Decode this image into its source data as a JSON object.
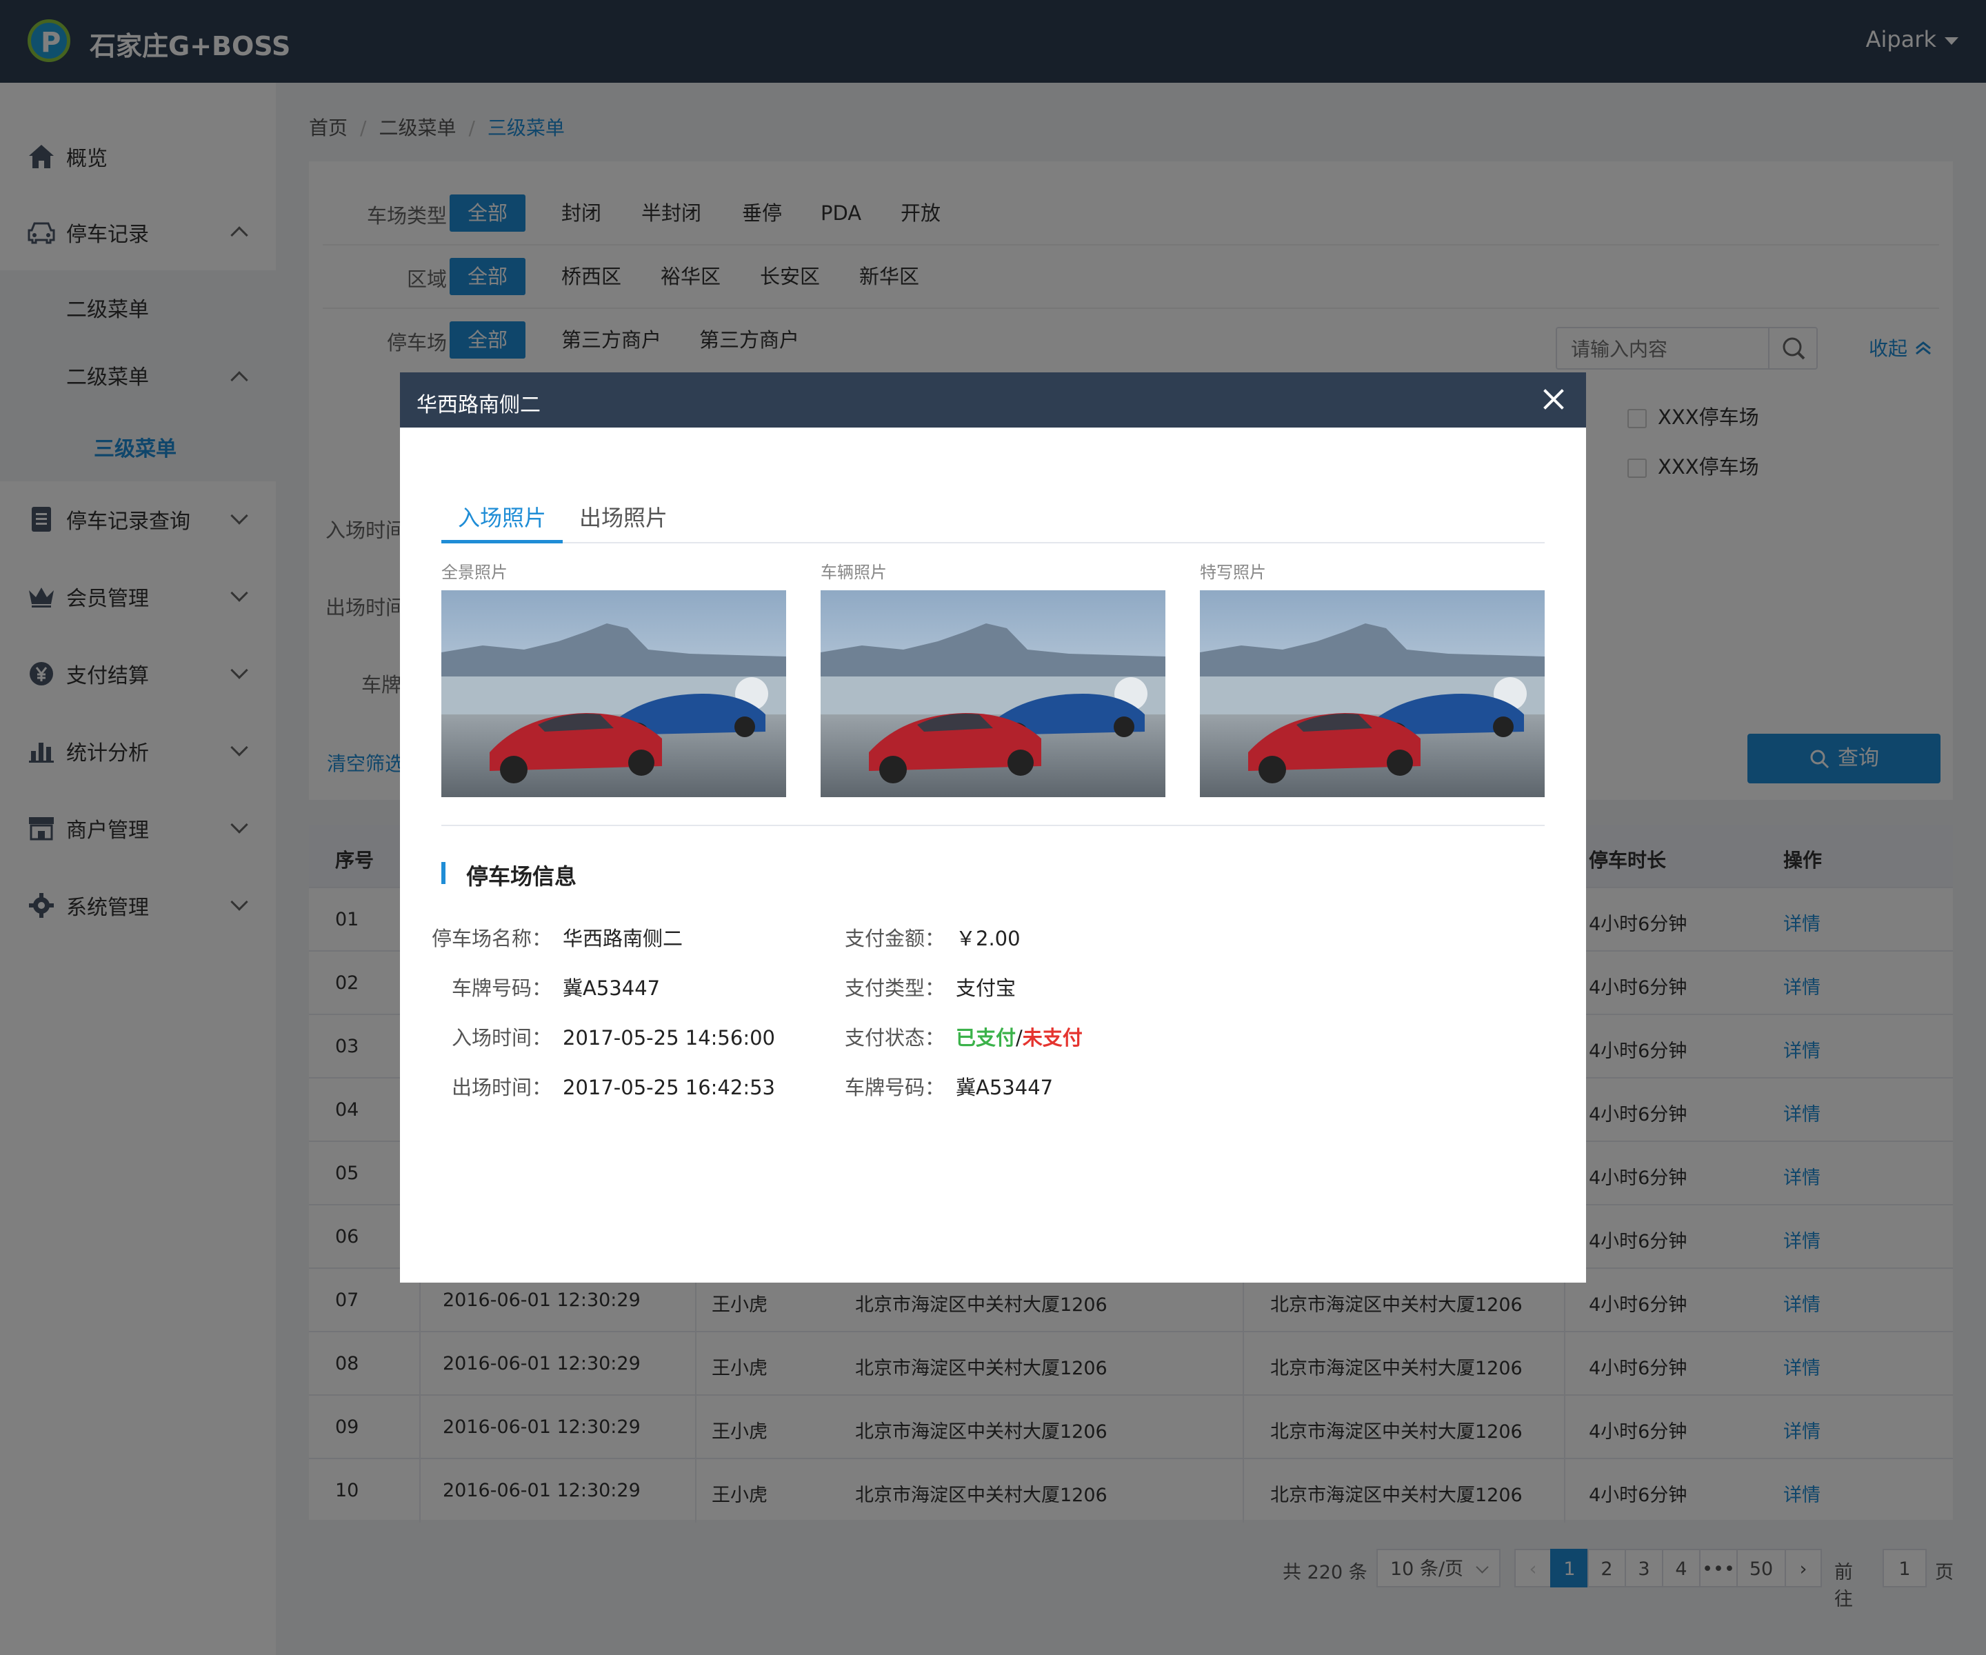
{
  "header": {
    "app_title": "石家庄G+BOSS",
    "user": "Aipark"
  },
  "sidebar": {
    "items": [
      {
        "label": "概览"
      },
      {
        "label": "停车记录"
      },
      {
        "label": "二级菜单"
      },
      {
        "label": "二级菜单"
      },
      {
        "label": "三级菜单"
      },
      {
        "label": "停车记录查询"
      },
      {
        "label": "会员管理"
      },
      {
        "label": "支付结算"
      },
      {
        "label": "统计分析"
      },
      {
        "label": "商户管理"
      },
      {
        "label": "系统管理"
      }
    ]
  },
  "breadcrumb": {
    "home": "首页",
    "level2": "二级菜单",
    "level3": "三级菜单"
  },
  "filters": {
    "lot_type": {
      "label": "车场类型",
      "options": [
        "全部",
        "封闭",
        "半封闭",
        "垂停",
        "PDA",
        "开放"
      ]
    },
    "region": {
      "label": "区域",
      "options": [
        "全部",
        "桥西区",
        "裕华区",
        "长安区",
        "新华区"
      ]
    },
    "parking_lot": {
      "label": "停车场",
      "options": [
        "全部",
        "第三方商户",
        "第三方商户"
      ]
    },
    "search_placeholder": "请输入内容",
    "collapse": "收起",
    "check1": "XXX停车场",
    "check2": "XXX停车场",
    "entry_time_label": "入场时间",
    "exit_time_label": "出场时间",
    "plate_label": "车牌",
    "clear": "清空筛选",
    "query": "查询"
  },
  "table": {
    "headers": {
      "index": "序号",
      "duration": "停车时长",
      "action": "操作"
    },
    "rows": [
      {
        "index": "01",
        "time": "",
        "name": "",
        "addr1": "",
        "addr2": "",
        "duration": "4小时6分钟",
        "action": "详情"
      },
      {
        "index": "02",
        "time": "",
        "name": "",
        "addr1": "",
        "addr2": "",
        "duration": "4小时6分钟",
        "action": "详情"
      },
      {
        "index": "03",
        "time": "",
        "name": "",
        "addr1": "",
        "addr2": "",
        "duration": "4小时6分钟",
        "action": "详情"
      },
      {
        "index": "04",
        "time": "",
        "name": "",
        "addr1": "",
        "addr2": "",
        "duration": "4小时6分钟",
        "action": "详情"
      },
      {
        "index": "05",
        "time": "",
        "name": "",
        "addr1": "",
        "addr2": "",
        "duration": "4小时6分钟",
        "action": "详情"
      },
      {
        "index": "06",
        "time": "",
        "name": "",
        "addr1": "",
        "addr2": "",
        "duration": "4小时6分钟",
        "action": "详情"
      },
      {
        "index": "07",
        "time": "2016-06-01 12:30:29",
        "name": "王小虎",
        "addr1": "北京市海淀区中关村大厦1206",
        "addr2": "北京市海淀区中关村大厦1206",
        "duration": "4小时6分钟",
        "action": "详情"
      },
      {
        "index": "08",
        "time": "2016-06-01 12:30:29",
        "name": "王小虎",
        "addr1": "北京市海淀区中关村大厦1206",
        "addr2": "北京市海淀区中关村大厦1206",
        "duration": "4小时6分钟",
        "action": "详情"
      },
      {
        "index": "09",
        "time": "2016-06-01 12:30:29",
        "name": "王小虎",
        "addr1": "北京市海淀区中关村大厦1206",
        "addr2": "北京市海淀区中关村大厦1206",
        "duration": "4小时6分钟",
        "action": "详情"
      },
      {
        "index": "10",
        "time": "2016-06-01 12:30:29",
        "name": "王小虎",
        "addr1": "北京市海淀区中关村大厦1206",
        "addr2": "北京市海淀区中关村大厦1206",
        "duration": "4小时6分钟",
        "action": "详情"
      }
    ]
  },
  "pagination": {
    "total": "共 220 条",
    "page_size": "10 条/页",
    "pages": [
      "1",
      "2",
      "3",
      "4",
      "•••",
      "50"
    ],
    "current": "1",
    "goto_prefix": "前往",
    "goto_value": "1",
    "goto_suffix": "页"
  },
  "modal": {
    "title": "华西路南侧二",
    "tabs": [
      "入场照片",
      "出场照片"
    ],
    "photo_labels": [
      "全景照片",
      "车辆照片",
      "特写照片"
    ],
    "section_title": "停车场信息",
    "left": [
      {
        "k": "停车场名称：",
        "v": "华西路南侧二"
      },
      {
        "k": "车牌号码：",
        "v": "冀A53447"
      },
      {
        "k": "入场时间：",
        "v": "2017-05-25 14:56:00"
      },
      {
        "k": "出场时间：",
        "v": "2017-05-25 16:42:53"
      }
    ],
    "right": [
      {
        "k": "支付金额：",
        "v": "￥2.00"
      },
      {
        "k": "支付类型：",
        "v": "支付宝"
      },
      {
        "k": "支付状态：",
        "paid": "已支付",
        "sep": "/",
        "unpaid": "未支付"
      },
      {
        "k": "车牌号码：",
        "v": "冀A53447"
      }
    ]
  },
  "colors": {
    "header_bg": "#2f3e52",
    "accent": "#1f8dd6",
    "paid": "#3bb24a",
    "unpaid": "#e5342f"
  }
}
